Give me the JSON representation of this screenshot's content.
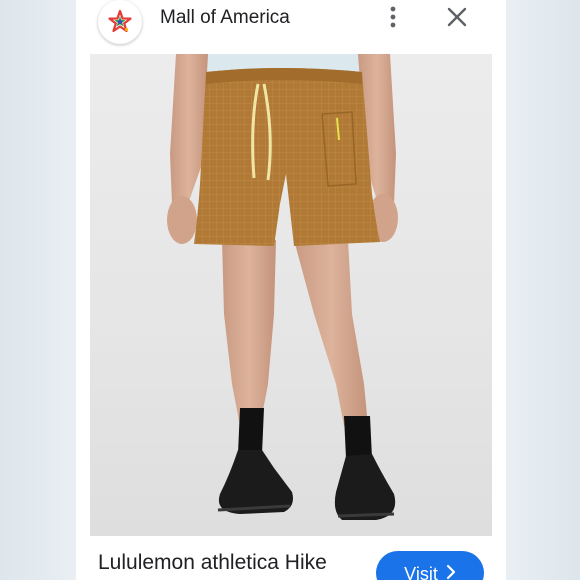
{
  "header": {
    "site_title": "Mall of America",
    "site_icon": "star-logo-icon",
    "more_icon": "more-vert-icon",
    "close_icon": "close-icon"
  },
  "product": {
    "image_icon": "product-photo",
    "title": "Lululemon athletica Hike",
    "visit_label": "Visit",
    "visit_icon": "chevron-right-icon"
  },
  "colors": {
    "accent": "#1a73e8",
    "title_text": "#202124",
    "icon_gray": "#5f6368",
    "shorts": "#b07a36",
    "star_red": "#e53935",
    "star_green": "#2e9e4f",
    "star_blue": "#3f51b5",
    "star_yellow": "#f6b300"
  }
}
